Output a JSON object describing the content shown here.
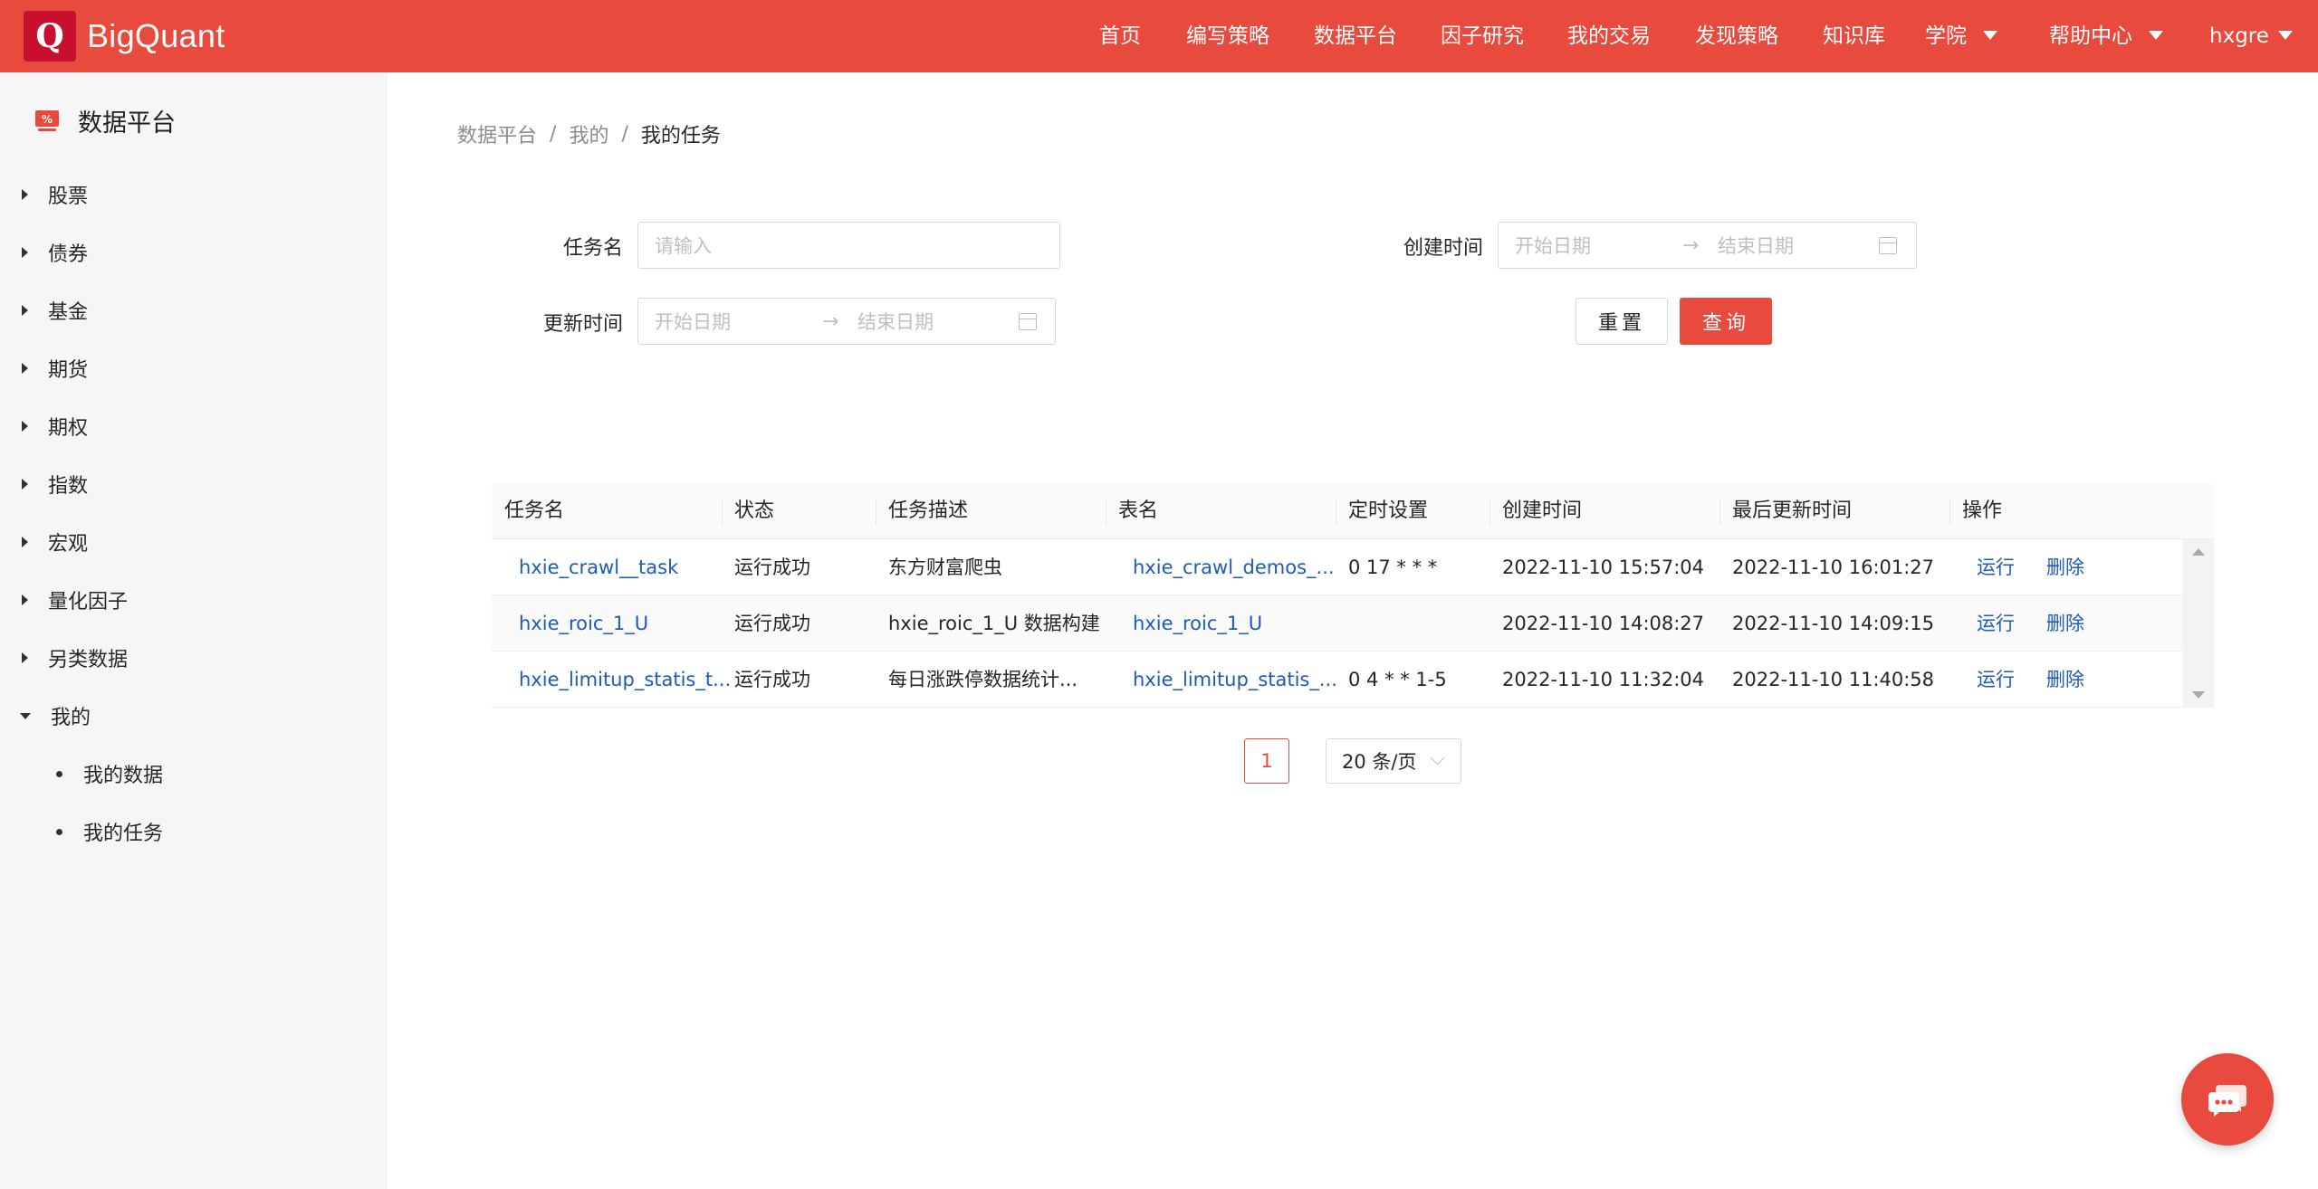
{
  "app": {
    "brand": "BigQuant",
    "logo_letter": "Q",
    "accent_color": "#e84a3d"
  },
  "nav": {
    "items": [
      "首页",
      "编写策略",
      "数据平台",
      "因子研究",
      "我的交易",
      "发现策略",
      "知识库",
      "学院",
      "帮助中心",
      "hxgre"
    ]
  },
  "sidebar": {
    "title": "数据平台",
    "items": [
      "股票",
      "债券",
      "基金",
      "期货",
      "期权",
      "指数",
      "宏观",
      "量化因子",
      "另类数据",
      "我的"
    ],
    "sub_items": [
      "我的数据",
      "我的任务"
    ]
  },
  "breadcrumb": [
    "数据平台",
    "我的",
    "我的任务"
  ],
  "form": {
    "task_name_label": "任务名",
    "task_name_placeholder": "请输入",
    "created_label": "创建时间",
    "updated_label": "更新时间",
    "start_placeholder": "开始日期",
    "end_placeholder": "结束日期",
    "range_arrow": "→",
    "reset_label": "重置",
    "query_label": "查询"
  },
  "table": {
    "columns": [
      "任务名",
      "状态",
      "任务描述",
      "表名",
      "定时设置",
      "创建时间",
      "最后更新时间",
      "操作"
    ],
    "rows": [
      {
        "name": "hxie_crawl__task",
        "status": "运行成功",
        "desc": "东方财富爬虫",
        "table": "hxie_crawl_demos_...",
        "cron": "0 17 * * *",
        "created": "2022-11-10 15:57:04",
        "updated": "2022-11-10 16:01:27",
        "run": "运行",
        "delete": "删除"
      },
      {
        "name": "hxie_roic_1_U",
        "status": "运行成功",
        "desc": "hxie_roic_1_U 数据构建",
        "table": "hxie_roic_1_U",
        "cron": "",
        "created": "2022-11-10 14:08:27",
        "updated": "2022-11-10 14:09:15",
        "run": "运行",
        "delete": "删除"
      },
      {
        "name": "hxie_limitup_statis_t...",
        "status": "运行成功",
        "desc": "每日涨跌停数据统计...",
        "table": "hxie_limitup_statis_...",
        "cron": "0 4 * * 1-5",
        "created": "2022-11-10 11:32:04",
        "updated": "2022-11-10 11:40:58",
        "run": "运行",
        "delete": "删除"
      }
    ]
  },
  "pagination": {
    "current_page": "1",
    "page_size": "20 条/页"
  }
}
